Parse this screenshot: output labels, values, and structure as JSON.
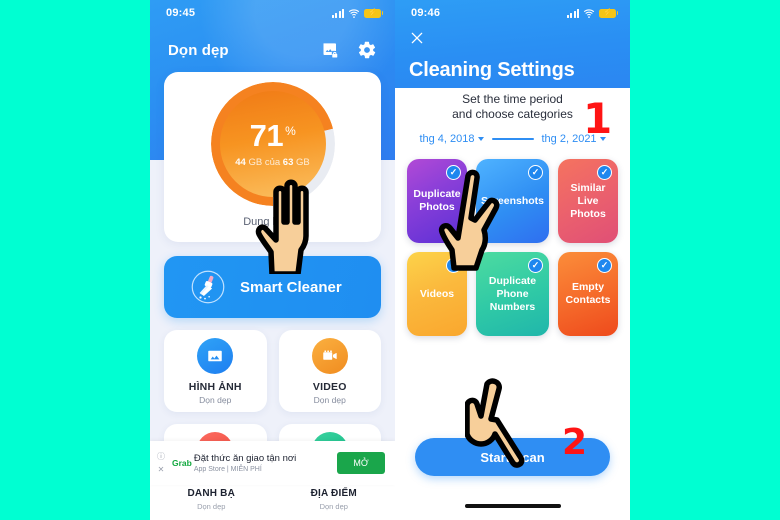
{
  "background_color": "#00ffd2",
  "left_phone": {
    "status_bar": {
      "time": "09:45",
      "signal_icon": "signal-bars-icon",
      "wifi_icon": "wifi-icon",
      "battery_icon": "battery-charging-icon"
    },
    "appbar": {
      "title": "Dọn dẹp",
      "photo_lock_icon": "photo-lock-icon",
      "settings_icon": "gear-icon"
    },
    "storage": {
      "percent": "71",
      "percent_symbol": "%",
      "used": "44",
      "used_unit": "GB",
      "of_word": "của",
      "total": "63",
      "total_unit": "GB",
      "label": "Dung lượng",
      "fill_ratio": 0.71,
      "ring_color": "#f58220"
    },
    "smart_cleaner": {
      "label": "Smart Cleaner",
      "icon": "broom-cleaner-icon",
      "color": "#2196f3"
    },
    "feature_tiles": [
      {
        "title": "HÌNH ẢNH",
        "subtitle": "Dọn dẹp",
        "icon": "photo-icon",
        "color": "#2fa3f7"
      },
      {
        "title": "VIDEO",
        "subtitle": "Dọn dẹp",
        "icon": "video-camera-icon",
        "color": "#fbb040"
      }
    ],
    "bottom_nav": [
      {
        "title": "DANH BẠ",
        "subtitle": "Dọn dẹp"
      },
      {
        "title": "ĐỊA ĐIỂM",
        "subtitle": "Dọn dẹp"
      }
    ],
    "ad": {
      "info_icon": "info-icon",
      "close_icon": "close-icon",
      "brand": "Grab",
      "title": "Đặt thức ăn giao tận nơi",
      "subtitle": "App Store | MIỄN PHÍ",
      "button": "MỞ",
      "button_color": "#1aa64b"
    }
  },
  "right_phone": {
    "status_bar": {
      "time": "09:46",
      "signal_icon": "signal-bars-icon",
      "wifi_icon": "wifi-icon",
      "battery_icon": "battery-charging-icon"
    },
    "close_icon": "close-icon",
    "title": "Cleaning Settings",
    "subtitle_line1": "Set the time period",
    "subtitle_line2": "and choose categories",
    "date_from": "thg 4, 2018",
    "date_to": "thg 2, 2021",
    "categories": [
      {
        "label": "Duplicate Photos",
        "checked": true,
        "style": "c-purple"
      },
      {
        "label": "Screenshots",
        "checked": true,
        "style": "c-blue"
      },
      {
        "label": "Similar Live Photos",
        "checked": true,
        "style": "c-pink"
      },
      {
        "label": "Videos",
        "checked": true,
        "style": "c-yellow"
      },
      {
        "label": "Duplicate Phone Numbers",
        "checked": true,
        "style": "c-green"
      },
      {
        "label": "Empty Contacts",
        "checked": true,
        "style": "c-orange"
      }
    ],
    "scan_button": "Start Scan",
    "check_mark": "✓"
  },
  "annotations": {
    "step_one": "1",
    "step_two": "2",
    "hand_color": "#f7cf9a",
    "number_color": "#ff1414",
    "pointer_icons": [
      "pointing-hand-icon",
      "pointing-hand-icon",
      "pointing-hand-icon"
    ]
  }
}
